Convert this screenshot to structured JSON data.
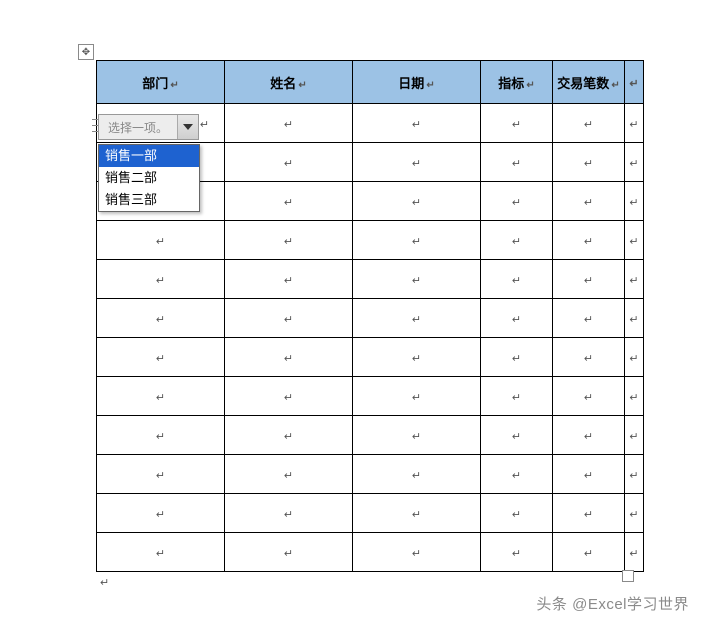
{
  "table": {
    "headers": [
      "部门",
      "姓名",
      "日期",
      "指标",
      "交易笔数"
    ],
    "row_count": 12,
    "paragraph_mark": "↵",
    "row_end_mark": "↵"
  },
  "dropdown": {
    "placeholder": "选择一项。",
    "options": [
      "销售一部",
      "销售二部",
      "销售三部"
    ],
    "selected_index": 0
  },
  "watermark": "头条 @Excel学习世界"
}
